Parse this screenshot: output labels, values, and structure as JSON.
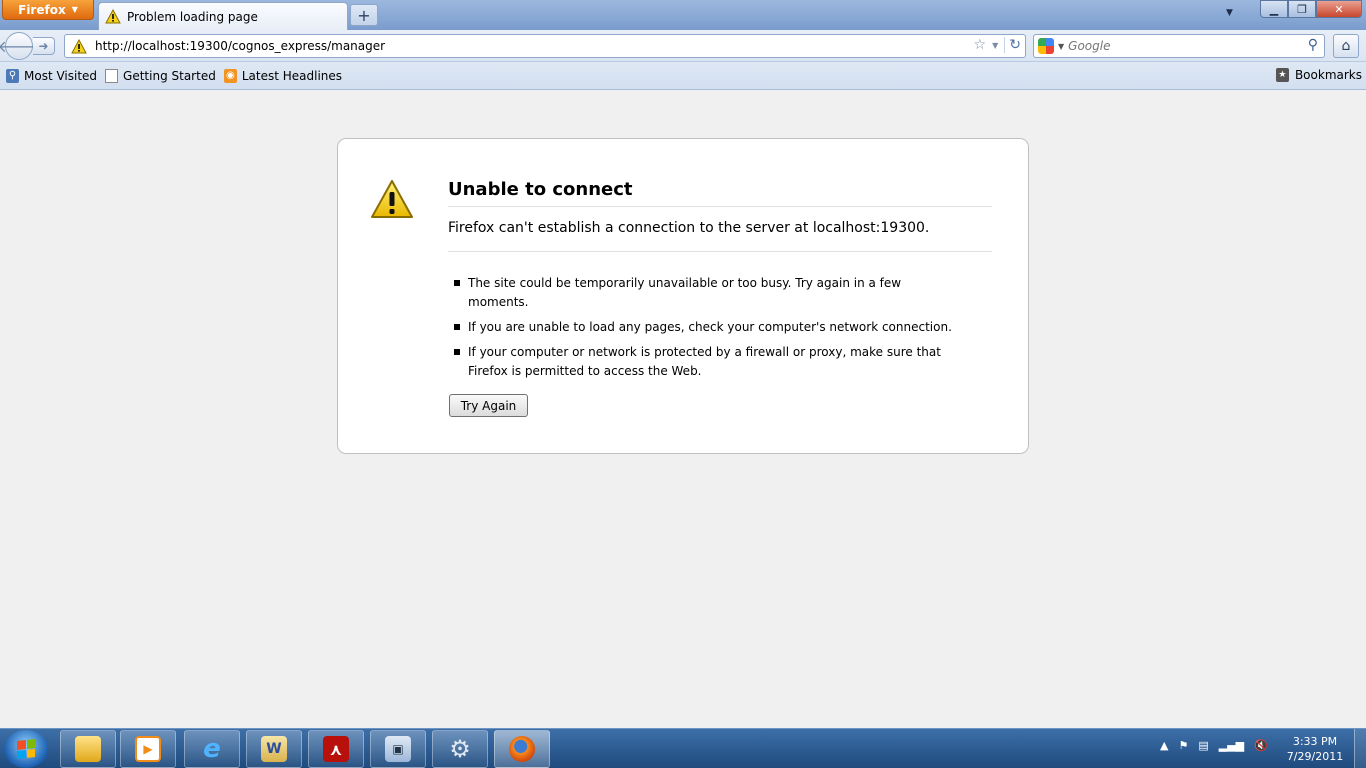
{
  "browser": {
    "menu_label": "Firefox",
    "tab_title": "Problem loading page",
    "url": "http://localhost:19300/cognos_express/manager",
    "search_placeholder": "Google"
  },
  "bookmarks": {
    "items": [
      {
        "label": "Most Visited",
        "icon": "most-visited-icon"
      },
      {
        "label": "Getting Started",
        "icon": "page-icon"
      },
      {
        "label": "Latest Headlines",
        "icon": "rss-icon"
      }
    ],
    "menu_label": "Bookmarks"
  },
  "error": {
    "title": "Unable to connect",
    "description": "Firefox can't establish a connection to the server at localhost:19300.",
    "items": [
      "The site could be temporarily unavailable or too busy. Try again in a few moments.",
      "If you are unable to load any pages, check your computer's network connection.",
      "If your computer or network is protected by a firewall or proxy, make sure that Firefox is permitted to access the Web."
    ],
    "try_again_label": "Try Again"
  },
  "taskbar": {
    "time": "3:33 PM",
    "date": "7/29/2011",
    "apps": [
      "file-explorer",
      "media-player",
      "internet-explorer",
      "word",
      "adobe-reader",
      "remote-desktop",
      "settings",
      "firefox"
    ]
  },
  "colors": {
    "firefox_orange": "#e06a0e",
    "warning_yellow": "#f5d21a",
    "taskbar_blue": "#1f4b7e"
  }
}
